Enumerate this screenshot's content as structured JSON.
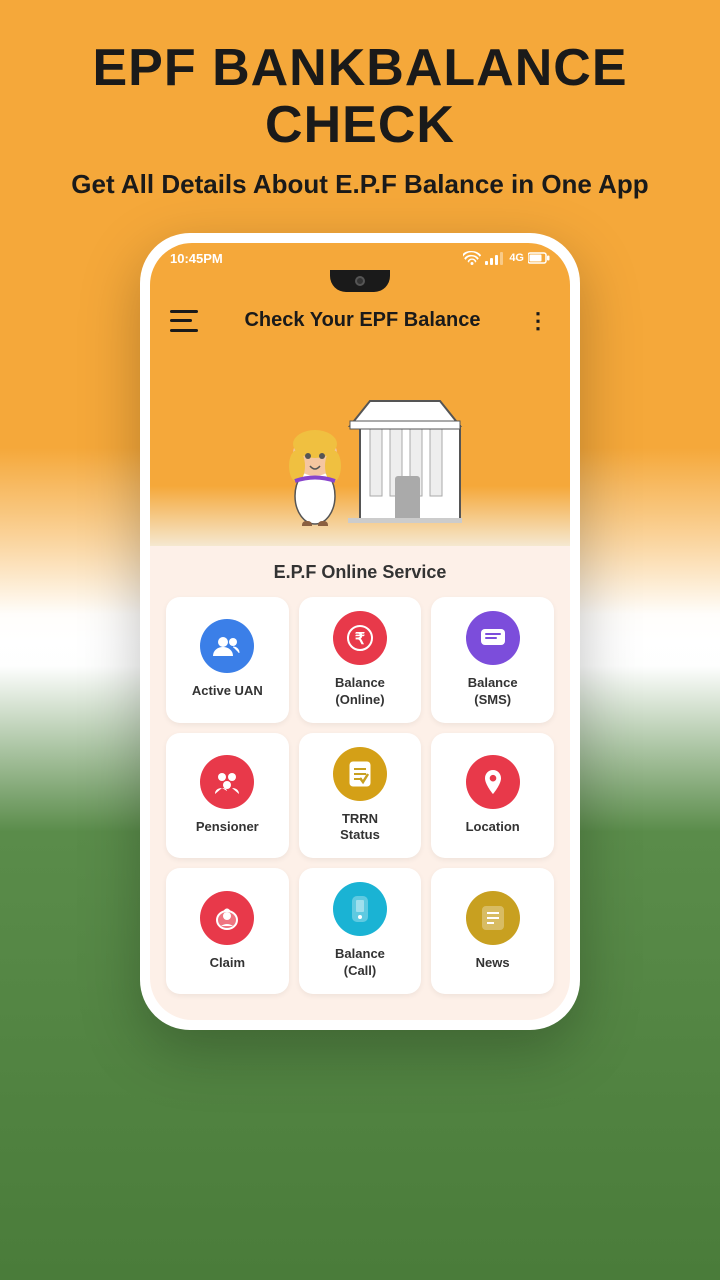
{
  "app": {
    "title": "EPF BANKBALANCE CHECK",
    "subtitle": "Get All Details About E.P.F Balance\nin One App"
  },
  "statusBar": {
    "time": "10:45PM",
    "wifi": "wifi",
    "network": "4G",
    "battery": "battery"
  },
  "appBar": {
    "title": "Check Your EPF Balance",
    "menuIcon": "hamburger-icon",
    "moreIcon": "more-dots"
  },
  "servicesSection": {
    "title": "E.P.F Online Service",
    "services": [
      {
        "id": "active-uan",
        "label": "Active UAN",
        "icon": "👥",
        "color": "ic-blue"
      },
      {
        "id": "balance-online",
        "label": "Balance\n(Online)",
        "icon": "₹",
        "color": "ic-red"
      },
      {
        "id": "balance-sms",
        "label": "Balance\n(SMS)",
        "icon": "💬",
        "color": "ic-purple"
      },
      {
        "id": "pensioner",
        "label": "Pensioner",
        "icon": "👥",
        "color": "ic-pink"
      },
      {
        "id": "trrn-status",
        "label": "TRRN\nStatus",
        "icon": "📋",
        "color": "ic-yellow"
      },
      {
        "id": "location",
        "label": "Location",
        "icon": "📍",
        "color": "ic-redloc"
      },
      {
        "id": "claim",
        "label": "Claim",
        "icon": "🐷",
        "color": "ic-claim"
      },
      {
        "id": "balance-call",
        "label": "Balance\n(Call)",
        "icon": "📱",
        "color": "ic-cyan"
      },
      {
        "id": "news",
        "label": "News",
        "icon": "📄",
        "color": "ic-gold"
      }
    ]
  }
}
